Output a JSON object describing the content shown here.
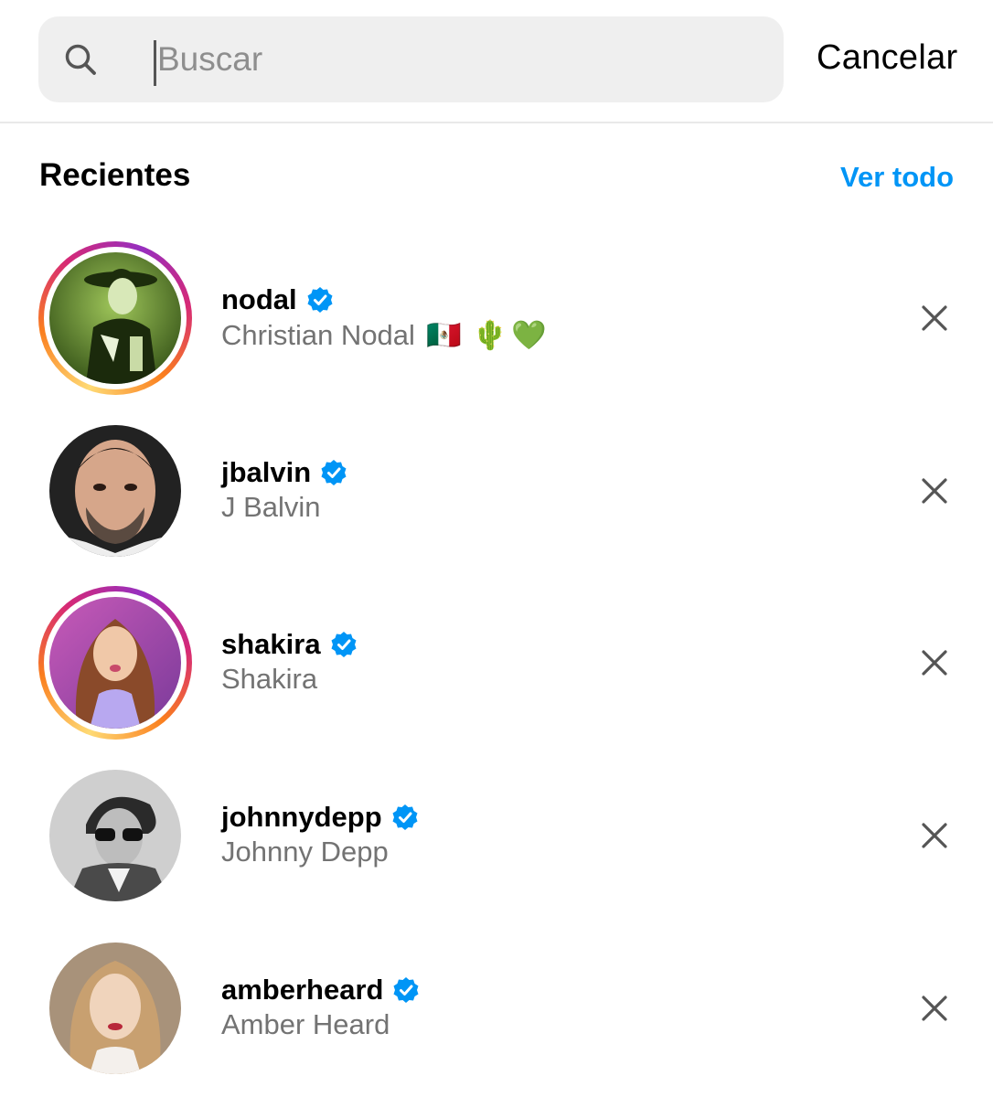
{
  "search": {
    "placeholder": "Buscar",
    "value": "",
    "cancel_label": "Cancelar"
  },
  "recents": {
    "title": "Recientes",
    "see_all_label": "Ver todo",
    "accent_color": "#0095f6",
    "items": [
      {
        "username": "nodal",
        "full_name": "Christian Nodal",
        "name_emojis": [
          "🇲🇽",
          "🌵",
          "💚"
        ],
        "verified": true,
        "has_story": true
      },
      {
        "username": "jbalvin",
        "full_name": "J Balvin",
        "name_emojis": [],
        "verified": true,
        "has_story": false
      },
      {
        "username": "shakira",
        "full_name": "Shakira",
        "name_emojis": [],
        "verified": true,
        "has_story": true
      },
      {
        "username": "johnnydepp",
        "full_name": "Johnny Depp",
        "name_emojis": [],
        "verified": true,
        "has_story": false
      },
      {
        "username": "amberheard",
        "full_name": "Amber Heard",
        "name_emojis": [],
        "verified": true,
        "has_story": false
      }
    ]
  }
}
